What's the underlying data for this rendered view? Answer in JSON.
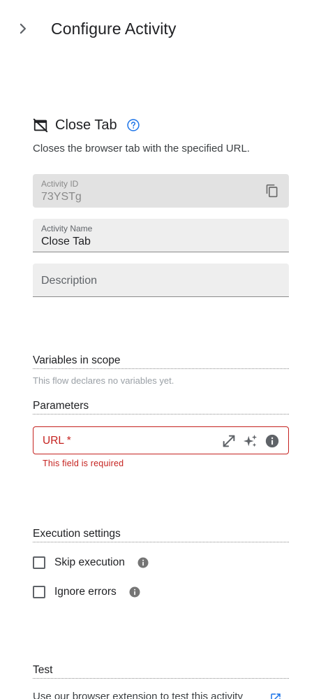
{
  "header": {
    "title": "Configure Activity"
  },
  "activity": {
    "title": "Close Tab",
    "description": "Closes the browser tab with the specified URL."
  },
  "fields": {
    "activity_id": {
      "label": "Activity ID",
      "value": "73YSTg"
    },
    "activity_name": {
      "label": "Activity Name",
      "value": "Close Tab"
    },
    "description": {
      "placeholder": "Description"
    }
  },
  "variables": {
    "heading": "Variables in scope",
    "note": "This flow declares no variables yet."
  },
  "parameters": {
    "heading": "Parameters",
    "url_label": "URL *",
    "error": "This field is required"
  },
  "execution": {
    "heading": "Execution settings",
    "skip_label": "Skip execution",
    "ignore_label": "Ignore errors"
  },
  "test": {
    "heading": "Test",
    "text": "Use our browser extension to test this activity"
  },
  "colors": {
    "error": "#c5221f",
    "link": "#1a73e8",
    "field_bg": "#eeeeee"
  }
}
